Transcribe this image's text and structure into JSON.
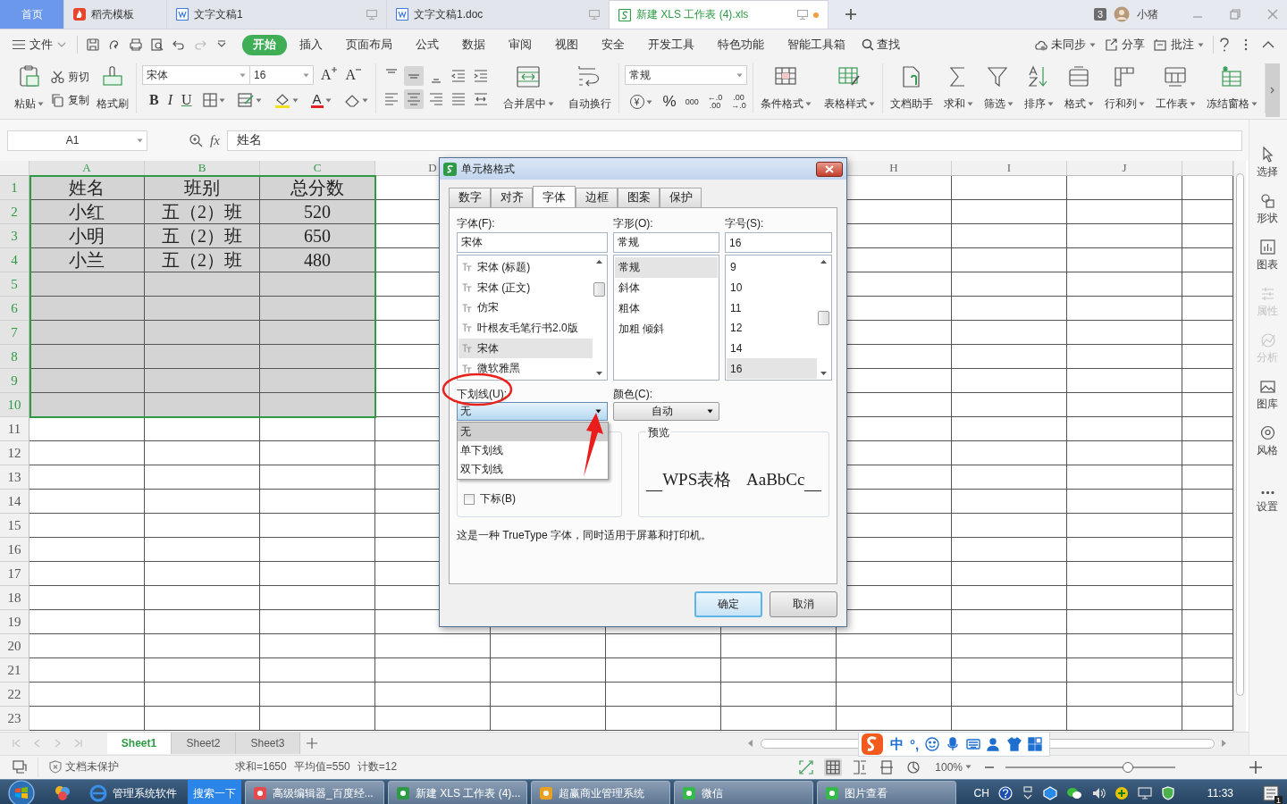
{
  "browser_tabs": [
    {
      "label": "首页",
      "kind": "home",
      "selected": false,
      "modified": false
    },
    {
      "label": "稻壳模板",
      "kind": "template",
      "selected": false,
      "modified": false
    },
    {
      "label": "文字文稿1",
      "kind": "doc",
      "selected": false,
      "modified": false
    },
    {
      "label": "文字文稿1.doc",
      "kind": "doc",
      "selected": false,
      "modified": false
    },
    {
      "label": "新建 XLS 工作表 (4).xls",
      "kind": "sheet",
      "selected": true,
      "modified": true
    }
  ],
  "window_count": "3",
  "user": "小猪",
  "menu": {
    "file": "文件",
    "tabs": [
      {
        "label": "开始",
        "selected": true
      },
      {
        "label": "插入",
        "selected": false
      },
      {
        "label": "页面布局",
        "selected": false
      },
      {
        "label": "公式",
        "selected": false
      },
      {
        "label": "数据",
        "selected": false
      },
      {
        "label": "审阅",
        "selected": false
      },
      {
        "label": "视图",
        "selected": false
      },
      {
        "label": "安全",
        "selected": false
      },
      {
        "label": "开发工具",
        "selected": false
      },
      {
        "label": "特色功能",
        "selected": false
      },
      {
        "label": "智能工具箱",
        "selected": false
      }
    ],
    "search": "查找",
    "actions": [
      "未同步",
      "分享",
      "批注"
    ]
  },
  "ribbon": {
    "paste": "粘贴",
    "cut": "剪切",
    "copy": "复制",
    "format_painter": "格式刷",
    "font": "宋体",
    "font_size": "16",
    "grow": "A",
    "shrink": "A",
    "format_buttons": [
      "B",
      "I",
      "U"
    ],
    "font_color": "A",
    "merge": "合并居中",
    "wrap": "自动换行",
    "number_format": "常规",
    "currency": "¥",
    "number_buttons": [
      {
        "lines": [
          "%"
        ]
      },
      {
        "lines": [
          "000"
        ]
      },
      {
        "lines": [
          "←.0",
          ".00"
        ]
      },
      {
        "lines": [
          ".00",
          "→.0"
        ]
      }
    ],
    "tools": [
      {
        "label": "条件格式",
        "dropdown": true
      },
      {
        "label": "表格样式",
        "dropdown": true
      },
      {
        "label": "文档助手",
        "dropdown": false
      },
      {
        "label": "求和",
        "dropdown": true
      },
      {
        "label": "筛选",
        "dropdown": true
      },
      {
        "label": "排序",
        "dropdown": true
      },
      {
        "label": "格式",
        "dropdown": true
      },
      {
        "label": "行和列",
        "dropdown": true
      },
      {
        "label": "工作表",
        "dropdown": true
      },
      {
        "label": "冻结窗格",
        "dropdown": true
      }
    ]
  },
  "formula_bar": {
    "cell": "A1",
    "fx": "fx",
    "value": "姓名"
  },
  "sheet": {
    "column_headers_left": [
      "A",
      "B",
      "C",
      "D"
    ],
    "column_headers_right": [
      "H",
      "I",
      "J"
    ],
    "rows": [
      {
        "number": "1",
        "selected": true,
        "cells": [
          "姓名",
          "班别",
          "总分数"
        ]
      },
      {
        "number": "2",
        "selected": true,
        "cells": [
          "小红",
          "五（2）班",
          "520"
        ]
      },
      {
        "number": "3",
        "selected": true,
        "cells": [
          "小明",
          "五（2）班",
          "650"
        ]
      },
      {
        "number": "4",
        "selected": true,
        "cells": [
          "小兰",
          "五（2）班",
          "480"
        ]
      },
      {
        "number": "5",
        "selected": true
      },
      {
        "number": "6",
        "selected": true
      },
      {
        "number": "7",
        "selected": true
      },
      {
        "number": "8",
        "selected": true
      },
      {
        "number": "9",
        "selected": true
      },
      {
        "number": "10",
        "selected": true
      },
      {
        "number": "11",
        "selected": false
      },
      {
        "number": "12",
        "selected": false
      },
      {
        "number": "13",
        "selected": false
      },
      {
        "number": "14",
        "selected": false
      },
      {
        "number": "15",
        "selected": false
      },
      {
        "number": "16",
        "selected": false
      },
      {
        "number": "17",
        "selected": false
      },
      {
        "number": "18",
        "selected": false
      },
      {
        "number": "19",
        "selected": false
      },
      {
        "number": "20",
        "selected": false
      },
      {
        "number": "21",
        "selected": false
      },
      {
        "number": "22",
        "selected": false
      },
      {
        "number": "23",
        "selected": false
      }
    ]
  },
  "sidebar": [
    {
      "label": "选择",
      "disabled": false
    },
    {
      "label": "形状",
      "disabled": false
    },
    {
      "label": "图表",
      "disabled": false
    },
    {
      "label": "属性",
      "disabled": true
    },
    {
      "label": "分析",
      "disabled": true
    },
    {
      "label": "图库",
      "disabled": false
    },
    {
      "label": "风格",
      "disabled": false
    },
    {
      "label": "设置",
      "disabled": false
    }
  ],
  "dialog": {
    "title": "单元格格式",
    "tabs": [
      {
        "label": "数字",
        "selected": false
      },
      {
        "label": "对齐",
        "selected": false
      },
      {
        "label": "字体",
        "selected": true
      },
      {
        "label": "边框",
        "selected": false
      },
      {
        "label": "图案",
        "selected": false
      },
      {
        "label": "保护",
        "selected": false
      }
    ],
    "font": {
      "label": "字体(F):",
      "value": "宋体",
      "options": [
        {
          "label": "宋体 (标题)",
          "selected": false
        },
        {
          "label": "宋体 (正文)",
          "selected": false
        },
        {
          "label": "仿宋",
          "selected": false
        },
        {
          "label": "叶根友毛笔行书2.0版",
          "selected": false
        },
        {
          "label": "宋体",
          "selected": true
        },
        {
          "label": "微软雅黑",
          "selected": false
        }
      ]
    },
    "style": {
      "label": "字形(O):",
      "value": "常规",
      "options": [
        {
          "label": "常规",
          "selected": true
        },
        {
          "label": "斜体",
          "selected": false
        },
        {
          "label": "粗体",
          "selected": false
        },
        {
          "label": "加粗 倾斜",
          "selected": false
        }
      ]
    },
    "size": {
      "label": "字号(S):",
      "value": "16",
      "options": [
        {
          "label": "9",
          "selected": false
        },
        {
          "label": "10",
          "selected": false
        },
        {
          "label": "11",
          "selected": false
        },
        {
          "label": "12",
          "selected": false
        },
        {
          "label": "14",
          "selected": false
        },
        {
          "label": "16",
          "selected": true
        }
      ]
    },
    "underline": {
      "label": "下划线(U):",
      "value": "无",
      "expanded": true,
      "options": [
        {
          "label": "无",
          "selected": true
        },
        {
          "label": "单下划线",
          "selected": false
        },
        {
          "label": "双下划线",
          "selected": false
        }
      ]
    },
    "color": {
      "label": "颜色(C):",
      "value": "自动"
    },
    "effects": [
      {
        "label": "下标(B)",
        "checked": false
      }
    ],
    "preview": {
      "label": "预览",
      "text": "WPS表格 AaBbCc"
    },
    "note": "这是一种 TrueType 字体，同时适用于屏幕和打印机。",
    "buttons": [
      {
        "label": "确定",
        "default": true
      },
      {
        "label": "取消",
        "default": false
      }
    ]
  },
  "annotations": [
    {
      "kind": "circle"
    },
    {
      "kind": "arrow"
    }
  ],
  "sheet_tabs": [
    {
      "label": "Sheet1",
      "selected": true
    },
    {
      "label": "Sheet2",
      "selected": false
    },
    {
      "label": "Sheet3",
      "selected": false
    }
  ],
  "ime": {
    "mode": "中",
    "punctuation": "°,"
  },
  "status": {
    "protection": "文档未保护",
    "summary": [
      "求和=1650",
      "平均值=550",
      "计数=12"
    ],
    "zoom": {
      "label": "100%",
      "level": 0.72
    }
  },
  "taskbar": {
    "items": [
      {
        "label": "管理系统软件",
        "kind": "browser"
      },
      {
        "label": "搜索一下",
        "kind": "search"
      },
      {
        "label": "高级编辑器_百度经...",
        "kind": "window"
      },
      {
        "label": "新建 XLS 工作表 (4)...",
        "kind": "window"
      },
      {
        "label": "超赢商业管理系统",
        "kind": "window"
      },
      {
        "label": "微信",
        "kind": "window"
      },
      {
        "label": "图片查看",
        "kind": "window"
      }
    ],
    "language": "CH",
    "time": "11:33",
    "notifications": "1"
  }
}
